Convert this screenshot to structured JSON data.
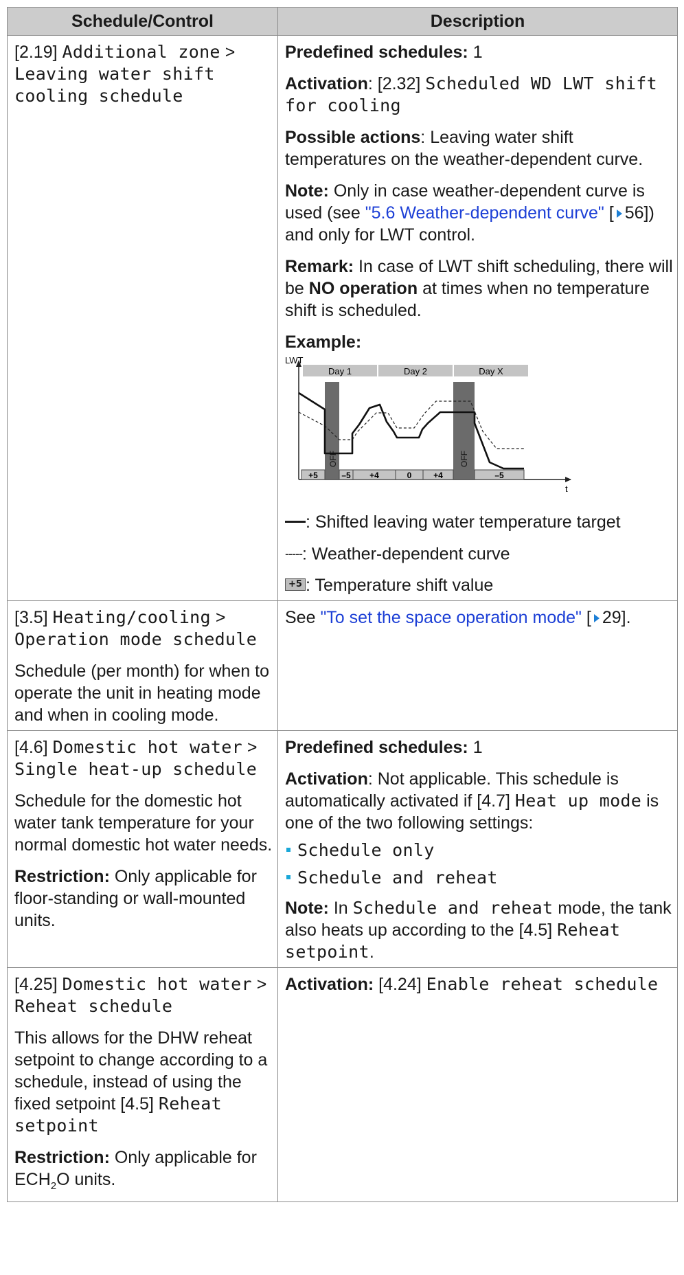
{
  "header": {
    "col1": "Schedule/Control",
    "col2": "Description"
  },
  "row1": {
    "ref": "[2.19]",
    "path_a": "Additional zone",
    "sep": ">",
    "path_b": "Leaving water shift cooling schedule",
    "predefined_label": "Predefined schedules:",
    "predefined_value": "1",
    "activation_label": "Activation",
    "activation_ref": "[2.32]",
    "activation_value": "Scheduled WD LWT shift for cooling",
    "actions_label": "Possible actions",
    "actions_text": "Leaving water shift temperatures on the weather-dependent curve.",
    "note_label": "Note:",
    "note_text_1": "Only in case weather-dependent curve is used (see",
    "note_link": "\"5.6 Weather-dependent curve\"",
    "note_page": "56",
    "note_text_2": ") and only for LWT control.",
    "remark_label": "Remark:",
    "remark_text_1": "In case of LWT shift scheduling, there will be",
    "remark_bold": "NO operation",
    "remark_text_2": "at times when no temperature shift is scheduled.",
    "example_label": "Example:",
    "legend": {
      "solid": ": Shifted leaving water temperature target",
      "dashed": ": Weather-dependent curve",
      "box_label": "+5",
      "box": ": Temperature shift value"
    }
  },
  "chart_data": {
    "type": "line",
    "ylabel": "LWT",
    "xlabel": "t",
    "day_labels": [
      "Day 1",
      "Day 2",
      "Day X"
    ],
    "off_label": "OFF",
    "shift_values": [
      "+5",
      "–5",
      "+4",
      "0",
      "+4",
      "–5"
    ],
    "series": [
      {
        "style": "solid"
      },
      {
        "style": "dashed"
      }
    ]
  },
  "row2": {
    "ref": "[3.5]",
    "path_a": "Heating/cooling",
    "sep": ">",
    "path_b": "Operation mode schedule",
    "desc": "Schedule (per month) for when to operate the unit in heating mode and when in cooling mode.",
    "see": "See",
    "see_link": "\"To set the space operation mode\"",
    "see_page": "29"
  },
  "row3": {
    "ref": "[4.6]",
    "path_a": "Domestic hot water",
    "sep": ">",
    "path_b": "Single heat-up schedule",
    "desc": "Schedule for the domestic hot water tank temperature for your normal domestic hot water needs.",
    "restriction_label": "Restriction:",
    "restriction_text": "Only applicable for floor-standing or wall-mounted units.",
    "predefined_label": "Predefined schedules:",
    "predefined_value": "1",
    "activation_label": "Activation",
    "activation_text_1": ": Not applicable. This schedule is automatically activated if [4.7]",
    "activation_mono": "Heat up mode",
    "activation_text_2": "is one of the two following settings:",
    "options": [
      "Schedule only",
      "Schedule and reheat"
    ],
    "note_label": "Note:",
    "note_text_1": "In",
    "note_mono": "Schedule and reheat",
    "note_text_2": "mode, the tank also heats up according to the [4.5]",
    "note_mono_2": "Reheat setpoint",
    "note_end": "."
  },
  "row4": {
    "ref": "[4.25]",
    "path_a": "Domestic hot water",
    "sep": ">",
    "path_b": "Reheat schedule",
    "desc_1": "This allows for the DHW reheat setpoint to change according to a schedule, instead of using the fixed setpoint [4.5]",
    "desc_mono": "Reheat setpoint",
    "restriction_label": "Restriction:",
    "restriction_text_1": "Only applicable for ECH",
    "restriction_sub": "2",
    "restriction_text_2": "O units.",
    "activation_label": "Activation:",
    "activation_ref": "[4.24]",
    "activation_value": "Enable reheat schedule"
  }
}
